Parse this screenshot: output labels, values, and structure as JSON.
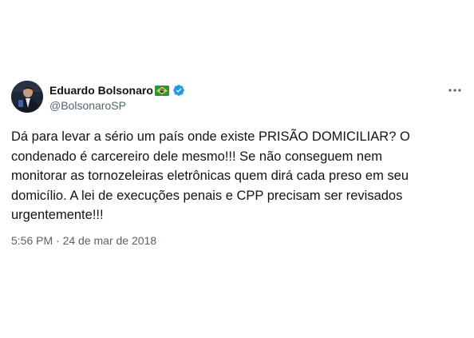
{
  "author": {
    "name": "Eduardo Bolsonaro",
    "handle": "@BolsonaroSP",
    "flag_icon": "brazil-flag-icon",
    "verified_icon": "verified-badge-icon",
    "verified_color": "#1d9bf0"
  },
  "tweet": {
    "lines": [
      "Dá para levar a sério um país onde existe PRISÃO DOMICILIAR? O",
      "condenado é carcereiro dele mesmo!!! Se não conseguem nem",
      "monitorar as tornozeleiras eletrônicas quem dirá cada preso em seu",
      "domicílio. A lei de execuções penais e CPP precisam ser revisados",
      "urgentemente!!!"
    ],
    "timestamp": "5:56 PM · 24 de mar de 2018"
  },
  "menu": {
    "icon": "more-options-icon"
  },
  "colors": {
    "text": "#0f1419",
    "secondary": "#536471"
  }
}
